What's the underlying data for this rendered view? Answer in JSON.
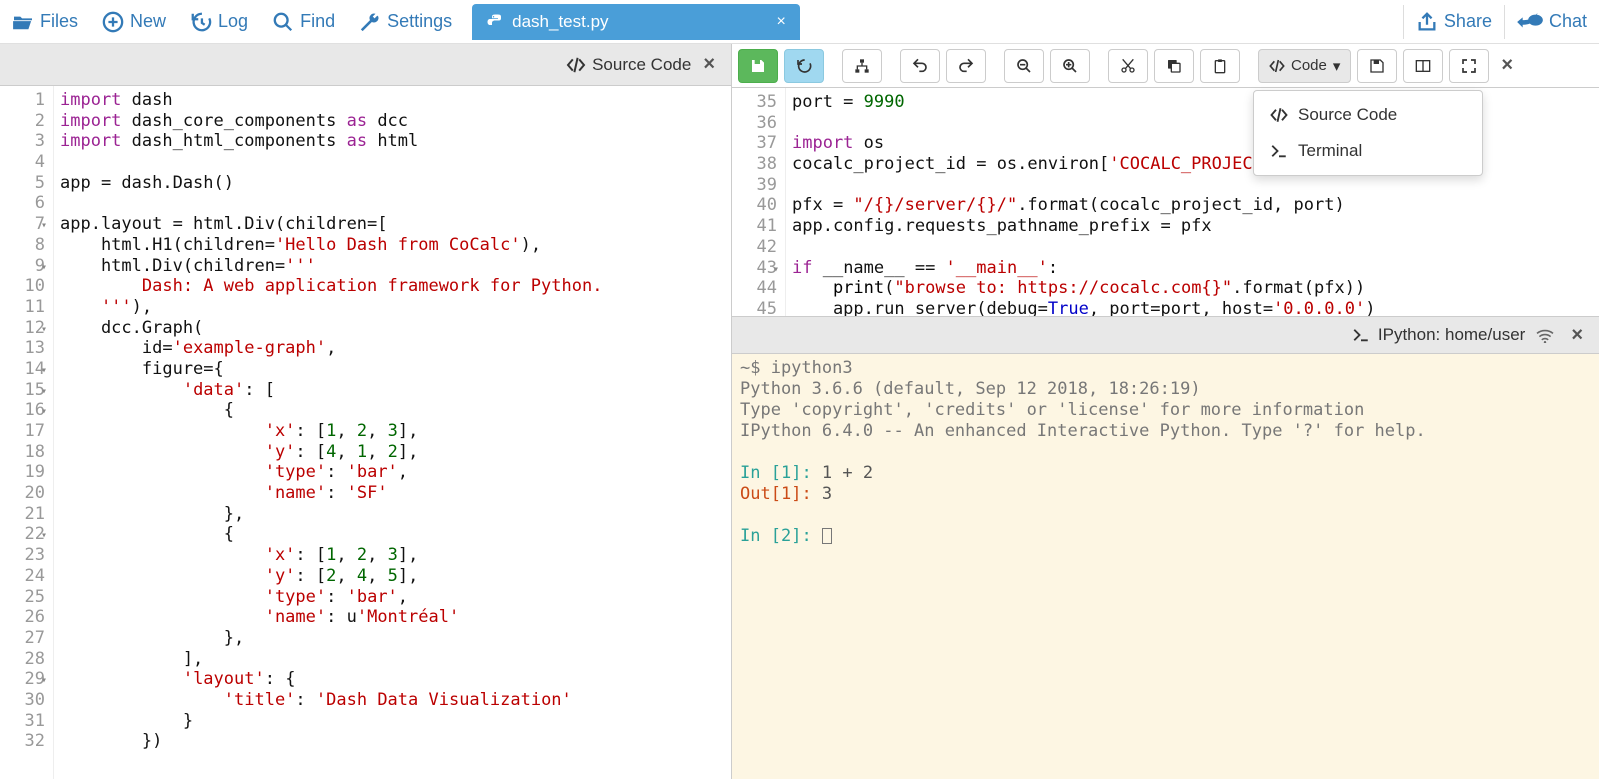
{
  "nav": {
    "files": "Files",
    "new": "New",
    "log": "Log",
    "find": "Find",
    "settings": "Settings",
    "share": "Share",
    "chat": "Chat"
  },
  "tab": {
    "filename": "dash_test.py"
  },
  "left_panel": {
    "title": "Source Code"
  },
  "left_code": {
    "lines": [
      {
        "n": 1,
        "html": "<span class='py-kw'>import</span> dash"
      },
      {
        "n": 2,
        "html": "<span class='py-kw'>import</span> dash_core_components <span class='py-kw'>as</span> dcc"
      },
      {
        "n": 3,
        "html": "<span class='py-kw'>import</span> dash_html_components <span class='py-kw'>as</span> html"
      },
      {
        "n": 4,
        "html": ""
      },
      {
        "n": 5,
        "html": "app = dash.Dash()"
      },
      {
        "n": 6,
        "html": ""
      },
      {
        "n": 7,
        "fold": true,
        "html": "app.layout = html.Div(children=["
      },
      {
        "n": 8,
        "html": "    html.H1(children=<span class='str'>'Hello Dash from CoCalc'</span>),"
      },
      {
        "n": 9,
        "fold": true,
        "html": "    html.Div(children=<span class='str'>'''</span>"
      },
      {
        "n": 10,
        "html": "<span class='str'>        Dash: A web application framework for Python.</span>"
      },
      {
        "n": 11,
        "html": "<span class='str'>    '''</span>),"
      },
      {
        "n": 12,
        "fold": true,
        "html": "    dcc.Graph("
      },
      {
        "n": 13,
        "html": "        id=<span class='str'>'example-graph'</span>,"
      },
      {
        "n": 14,
        "fold": true,
        "html": "        figure={"
      },
      {
        "n": 15,
        "fold": true,
        "html": "            <span class='str'>'data'</span>: ["
      },
      {
        "n": 16,
        "fold": true,
        "html": "                {"
      },
      {
        "n": 17,
        "html": "                    <span class='str'>'x'</span>: [<span class='num'>1</span>, <span class='num'>2</span>, <span class='num'>3</span>],"
      },
      {
        "n": 18,
        "html": "                    <span class='str'>'y'</span>: [<span class='num'>4</span>, <span class='num'>1</span>, <span class='num'>2</span>],"
      },
      {
        "n": 19,
        "html": "                    <span class='str'>'type'</span>: <span class='str'>'bar'</span>,"
      },
      {
        "n": 20,
        "html": "                    <span class='str'>'name'</span>: <span class='str'>'SF'</span>"
      },
      {
        "n": 21,
        "html": "                },"
      },
      {
        "n": 22,
        "fold": true,
        "html": "                {"
      },
      {
        "n": 23,
        "html": "                    <span class='str'>'x'</span>: [<span class='num'>1</span>, <span class='num'>2</span>, <span class='num'>3</span>],"
      },
      {
        "n": 24,
        "html": "                    <span class='str'>'y'</span>: [<span class='num'>2</span>, <span class='num'>4</span>, <span class='num'>5</span>],"
      },
      {
        "n": 25,
        "html": "                    <span class='str'>'type'</span>: <span class='str'>'bar'</span>,"
      },
      {
        "n": 26,
        "html": "                    <span class='str'>'name'</span>: u<span class='str'>'Montréal'</span>"
      },
      {
        "n": 27,
        "html": "                },"
      },
      {
        "n": 28,
        "html": "            ],"
      },
      {
        "n": 29,
        "fold": true,
        "html": "            <span class='str'>'layout'</span>: {"
      },
      {
        "n": 30,
        "html": "                <span class='str'>'title'</span>: <span class='str'>'Dash Data Visualization'</span>"
      },
      {
        "n": 31,
        "html": "            }"
      },
      {
        "n": 32,
        "html": "        })"
      }
    ]
  },
  "right_toolbar": {
    "code_label": "Code"
  },
  "dropdown": {
    "source_code": "Source Code",
    "terminal": "Terminal"
  },
  "right_code": {
    "lines": [
      {
        "n": 35,
        "html": "port = <span class='num'>9990</span>"
      },
      {
        "n": 36,
        "html": ""
      },
      {
        "n": 37,
        "html": "<span class='py-kw'>import</span> os"
      },
      {
        "n": 38,
        "html": "cocalc_project_id = os.environ[<span class='str'>'COCALC_PROJEC</span>"
      },
      {
        "n": 39,
        "html": ""
      },
      {
        "n": 40,
        "html": "pfx = <span class='str'>\"/{}/server/{}/\"</span>.format(cocalc_project_id, port)"
      },
      {
        "n": 41,
        "html": "app.config.requests_pathname_prefix = pfx"
      },
      {
        "n": 42,
        "html": ""
      },
      {
        "n": 43,
        "fold": true,
        "html": "<span class='py-kw'>if</span> __name__ == <span class='str'>'__main__'</span>:"
      },
      {
        "n": 44,
        "html": "    <span class='fn'>print</span>(<span class='str'>\"browse to: https://cocalc.com{}\"</span>.format(pfx))"
      },
      {
        "n": 45,
        "html": "    app.run_server(debug=<span class='kw'>True</span>, port=port, host=<span class='str'>'0.0.0.0'</span>)"
      }
    ]
  },
  "terminal_header": {
    "title": "IPython: home/user"
  },
  "terminal": {
    "prompt": "~$ ipython3",
    "banner1": "Python 3.6.6 (default, Sep 12 2018, 18:26:19)",
    "banner2": "Type 'copyright', 'credits' or 'license' for more information",
    "banner3": "IPython 6.4.0 -- An enhanced Interactive Python. Type '?' for help.",
    "in1_label": "In [",
    "in1_n": "1",
    "in1_close": "]: ",
    "in1_body": "1 + 2",
    "out1_label": "Out[",
    "out1_n": "1",
    "out1_close": "]: ",
    "out1_body": "3",
    "in2_label": "In [",
    "in2_n": "2",
    "in2_close": "]: "
  }
}
